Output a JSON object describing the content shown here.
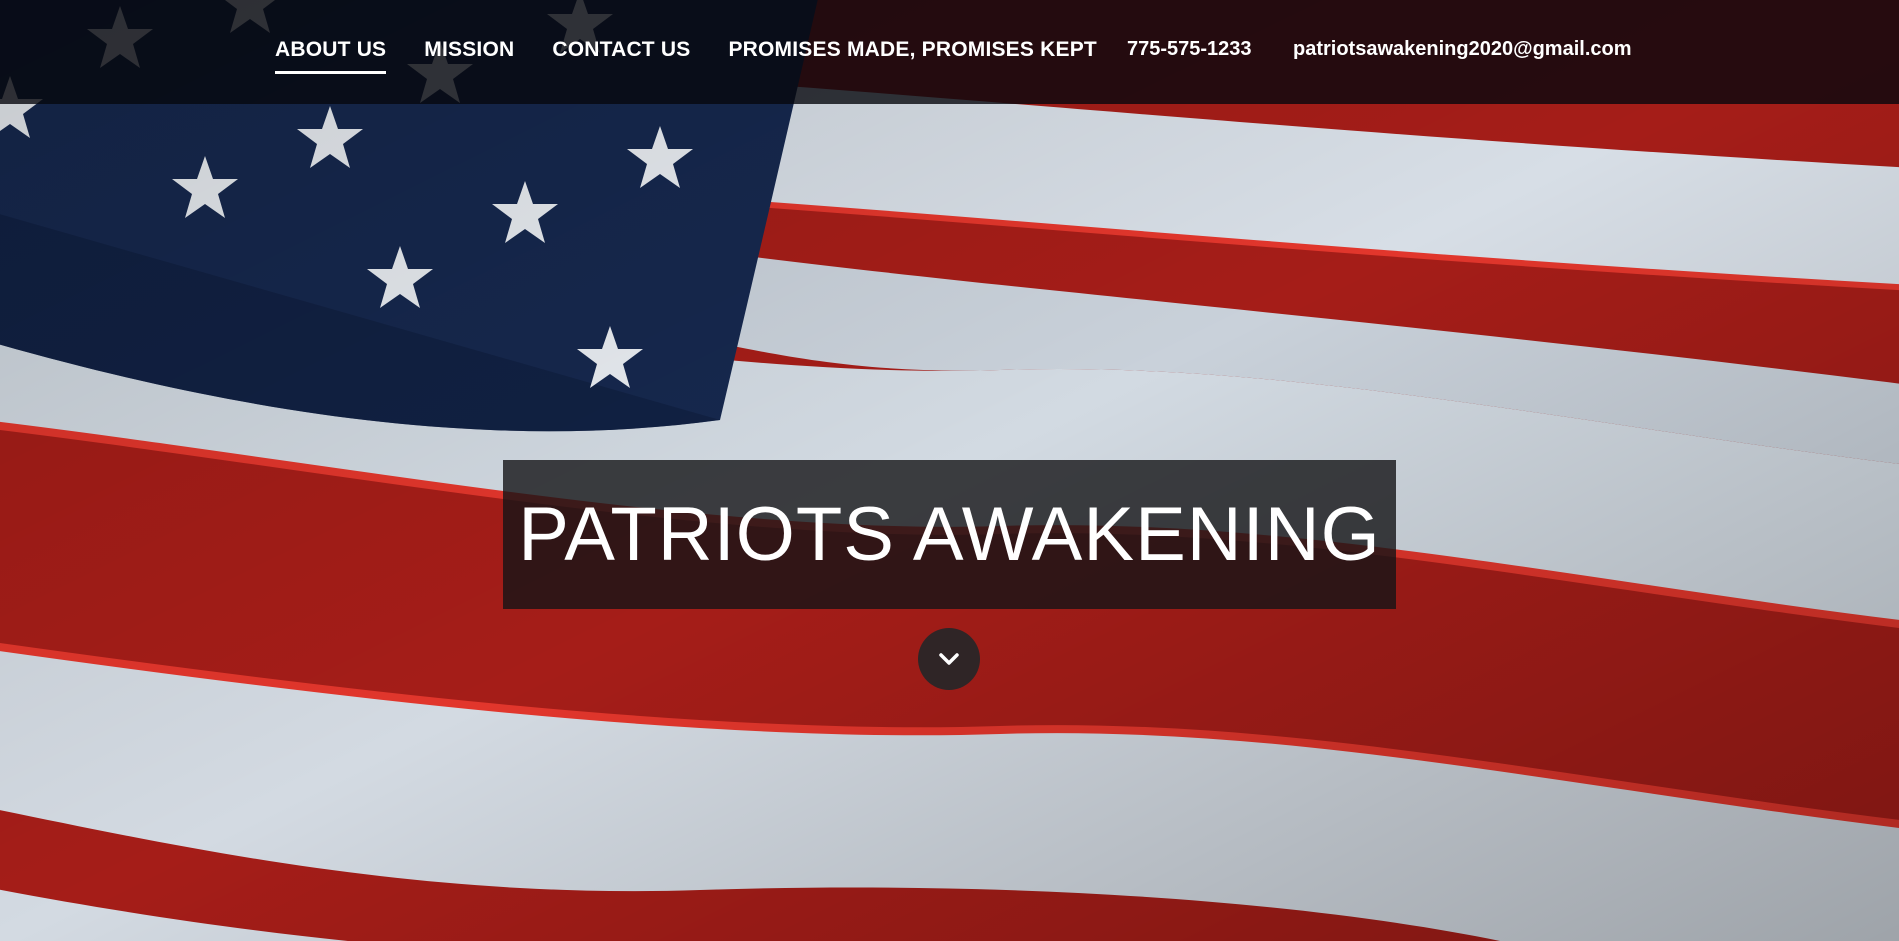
{
  "nav": {
    "items": [
      {
        "label": "ABOUT US",
        "active": true
      },
      {
        "label": "MISSION",
        "active": false
      },
      {
        "label": "CONTACT US",
        "active": false
      },
      {
        "label": "PROMISES MADE, PROMISES KEPT",
        "active": false
      }
    ],
    "phone": "775-575-1233",
    "email": "patriotsawakening2020@gmail.com"
  },
  "hero": {
    "title": "PATRIOTS AWAKENING",
    "background": "american-flag-photo",
    "scroll_icon": "chevron-down-icon"
  },
  "colors": {
    "stripe_red": "#b8231d",
    "stripe_white": "#d6dde4",
    "canton_blue": "#14254a",
    "topbar": "#06080e"
  }
}
